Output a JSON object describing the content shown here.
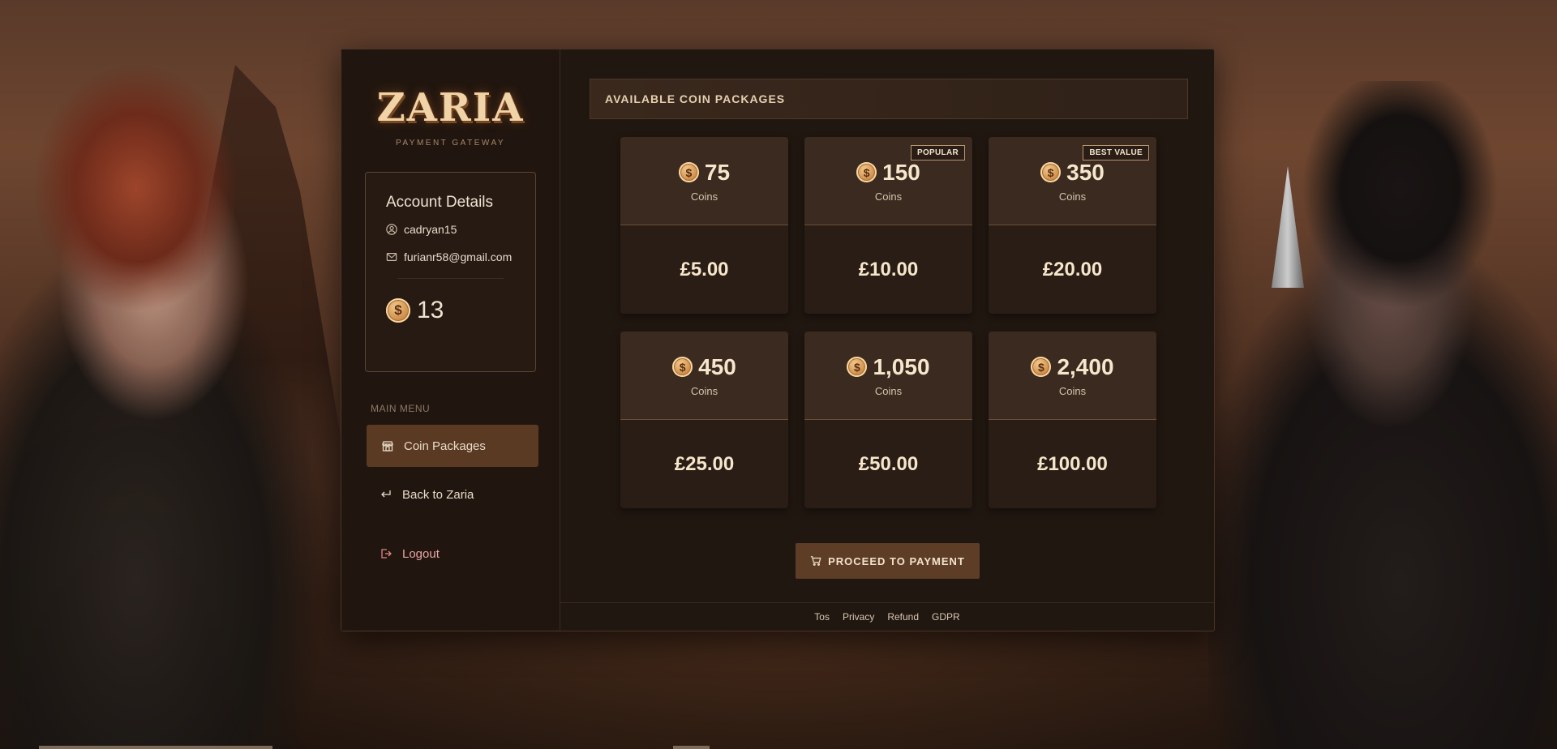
{
  "brand": {
    "logo_text": "ZARIA",
    "subtitle": "PAYMENT GATEWAY"
  },
  "account": {
    "title": "Account Details",
    "username": "cadryan15",
    "email": "furianr58@gmail.com",
    "coin_balance": "13"
  },
  "menu": {
    "label": "MAIN MENU",
    "items": [
      {
        "label": "Coin Packages",
        "icon": "shop-icon",
        "active": true
      },
      {
        "label": "Back to Zaria",
        "icon": "return-arrow-icon",
        "active": false
      },
      {
        "label": "Logout",
        "icon": "logout-icon",
        "active": false
      }
    ]
  },
  "section": {
    "title": "AVAILABLE COIN PACKAGES"
  },
  "packages": [
    {
      "amount": "75",
      "unit": "Coins",
      "price": "£5.00",
      "badge": ""
    },
    {
      "amount": "150",
      "unit": "Coins",
      "price": "£10.00",
      "badge": "POPULAR"
    },
    {
      "amount": "350",
      "unit": "Coins",
      "price": "£20.00",
      "badge": "BEST VALUE"
    },
    {
      "amount": "450",
      "unit": "Coins",
      "price": "£25.00",
      "badge": ""
    },
    {
      "amount": "1,050",
      "unit": "Coins",
      "price": "£50.00",
      "badge": ""
    },
    {
      "amount": "2,400",
      "unit": "Coins",
      "price": "£100.00",
      "badge": ""
    }
  ],
  "actions": {
    "proceed_label": "PROCEED TO PAYMENT"
  },
  "coin_symbol": "$",
  "footer": {
    "links": [
      "Tos",
      "Privacy",
      "Refund",
      "GDPR"
    ]
  },
  "colors": {
    "accent": "#5e3d27",
    "active_menu": "#5a3a22",
    "logout": "#e7a3a3",
    "panel_bg": "#211711"
  }
}
